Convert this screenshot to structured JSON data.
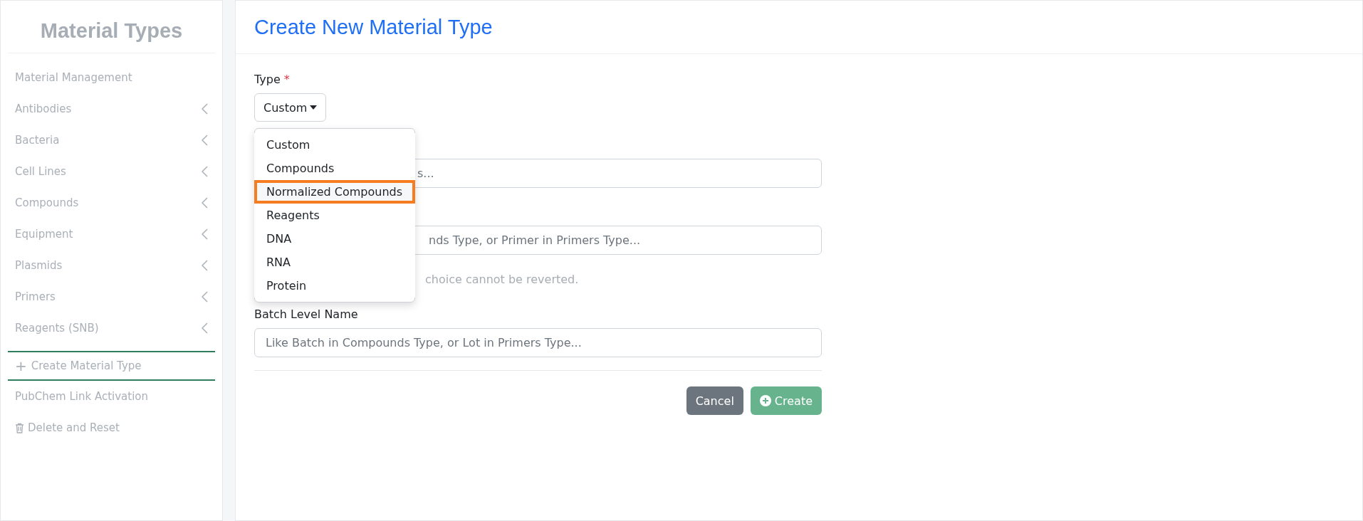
{
  "sidebar": {
    "title": "Material Types",
    "items": [
      {
        "label": "Material Management",
        "kind": "plain"
      },
      {
        "label": "Antibodies",
        "kind": "group"
      },
      {
        "label": "Bacteria",
        "kind": "group"
      },
      {
        "label": "Cell Lines",
        "kind": "group"
      },
      {
        "label": "Compounds",
        "kind": "group"
      },
      {
        "label": "Equipment",
        "kind": "group"
      },
      {
        "label": "Plasmids",
        "kind": "group"
      },
      {
        "label": "Primers",
        "kind": "group"
      },
      {
        "label": "Reagents (SNB)",
        "kind": "group"
      }
    ],
    "create": {
      "icon": "+",
      "label": "Create Material Type"
    },
    "footer": [
      {
        "label": "PubChem Link Activation",
        "kind": "plain"
      },
      {
        "label": "Delete and Reset",
        "kind": "trash"
      }
    ]
  },
  "form": {
    "title": "Create New Material Type",
    "type_label": "Type",
    "required_mark": "*",
    "type_value": "Custom",
    "menu": [
      {
        "label": "Custom",
        "selected": false
      },
      {
        "label": "Compounds",
        "selected": false
      },
      {
        "label": "Normalized Compounds",
        "selected": true
      },
      {
        "label": "Reagents",
        "selected": false
      },
      {
        "label": "DNA",
        "selected": false
      },
      {
        "label": "RNA",
        "selected": false
      },
      {
        "label": "Protein",
        "selected": false
      }
    ],
    "field_1": {
      "placeholder": "s..."
    },
    "field_2": {
      "placeholder": "nds Type, or Primer in Primers Type..."
    },
    "checkbox": {
      "label": "choice cannot be reverted."
    },
    "batch_label": "Batch Level Name",
    "batch_field": {
      "placeholder": "Like Batch in Compounds Type, or Lot in Primers Type..."
    },
    "buttons": [
      {
        "label": "Cancel",
        "kind": "cancel"
      },
      {
        "label": "Create",
        "kind": "create"
      }
    ]
  }
}
